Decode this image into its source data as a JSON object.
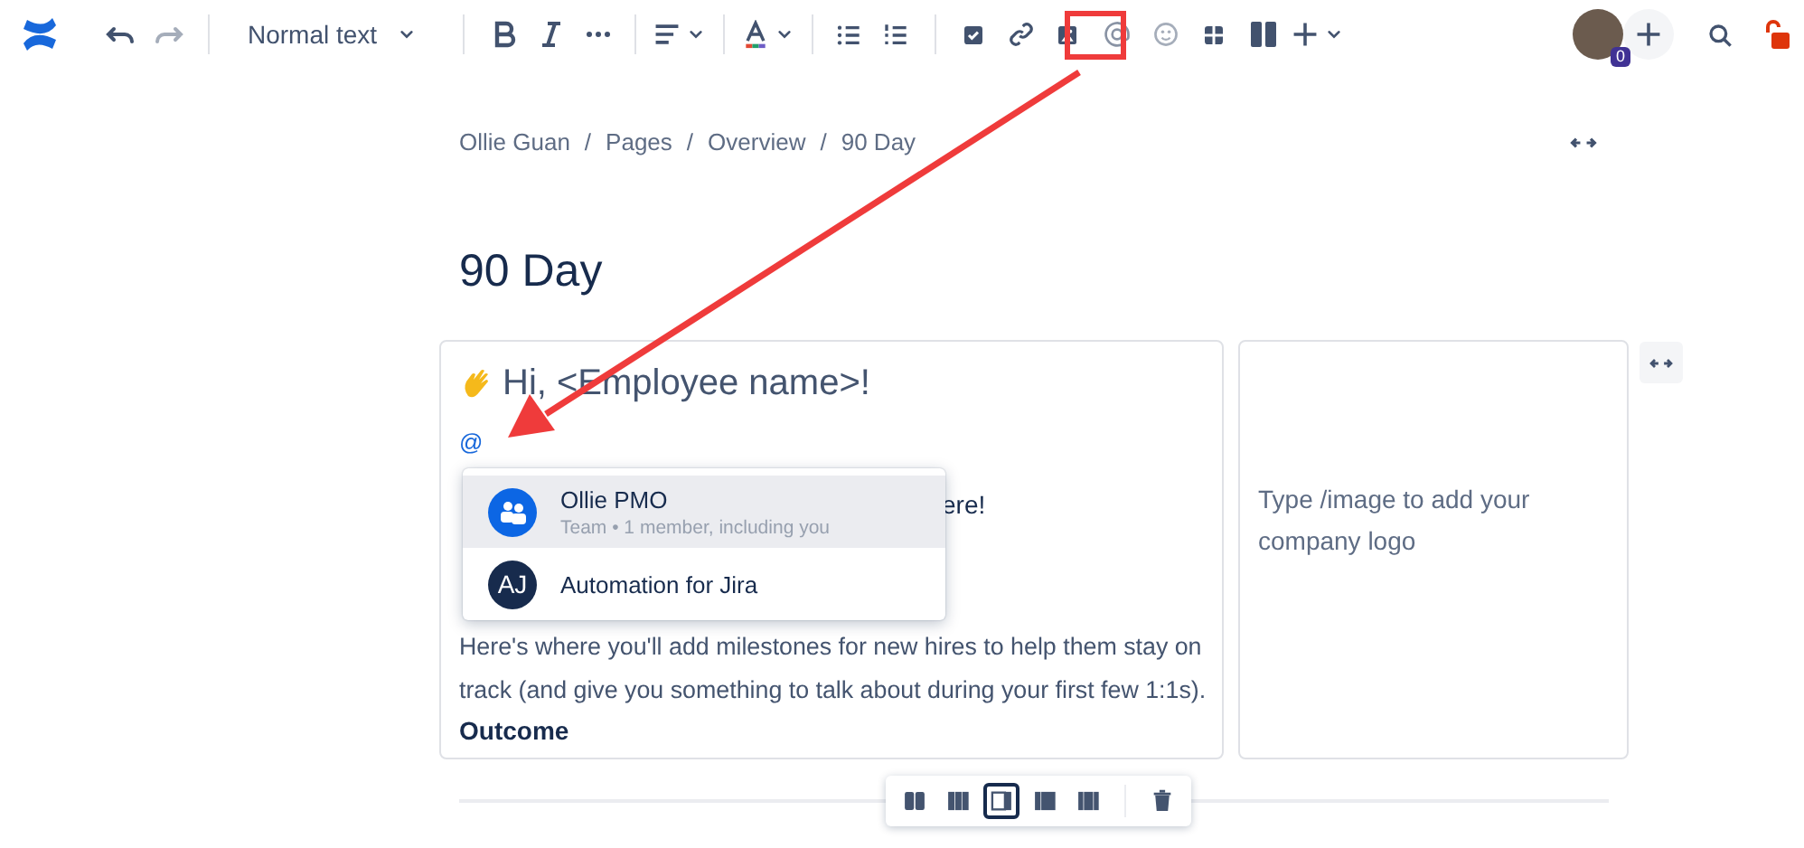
{
  "toolbar": {
    "undo": {
      "disabled": false
    },
    "redo": {
      "disabled": true
    },
    "text_style": "Normal text",
    "emoji": {
      "disabled": true
    },
    "collaborator_count": "0"
  },
  "breadcrumbs": {
    "separator": "/",
    "items": [
      "Ollie Guan",
      "Pages",
      "Overview",
      "90 Day"
    ]
  },
  "title": "90 Day",
  "left_cell": {
    "heading": "Hi, <Employee name>!",
    "mention_trigger": "@",
    "covered_line_end": "ere!",
    "paragraph": "Here's where you'll add milestones for new hires to help them stay on track (and give you something to talk about during your first few 1:1s).",
    "subheading": "Outcome"
  },
  "mention_menu": {
    "items": [
      {
        "kind": "team",
        "name": "Ollie PMO",
        "detail": "Team • 1 member, including you",
        "selected": true
      },
      {
        "kind": "initials",
        "initials": "AJ",
        "name": "Automation for Jira",
        "selected": false
      }
    ]
  },
  "right_cell": {
    "placeholder": "Type /image to add your company logo"
  },
  "layout_options": [
    {
      "selected": false
    },
    {
      "selected": false
    },
    {
      "selected": true
    },
    {
      "selected": false
    },
    {
      "selected": false
    }
  ]
}
